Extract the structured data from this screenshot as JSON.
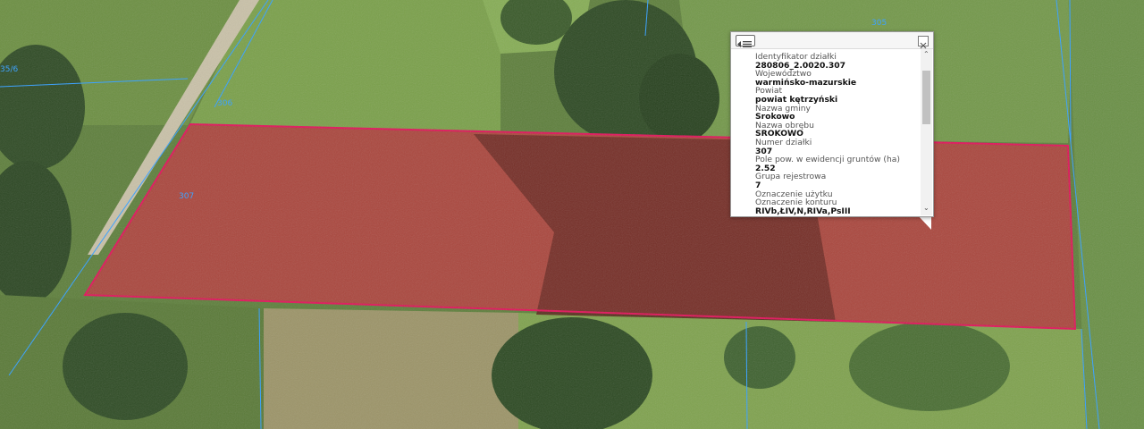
{
  "map": {
    "parcel_labels": [
      "305",
      "306",
      "307",
      "35/6"
    ],
    "colors": {
      "parcel_outline": "#e0145a",
      "parcel_fill": "#c0263e",
      "boundary_lines": "#3ea3ff"
    }
  },
  "popup": {
    "menu_icon": "list-menu-icon",
    "close_icon": "close-icon",
    "fields": [
      {
        "label": "Identyfikator działki",
        "value": "280806_2.0020.307"
      },
      {
        "label": "Województwo",
        "value": "warmińsko-mazurskie"
      },
      {
        "label": "Powiat",
        "value": "powiat kętrzyński"
      },
      {
        "label": "Nazwa gminy",
        "value": "Srokowo"
      },
      {
        "label": "Nazwa obrębu",
        "value": "SROKOWO"
      },
      {
        "label": "Numer działki",
        "value": "307"
      },
      {
        "label": "Pole pow. w ewidencji gruntów (ha)",
        "value": "2.52"
      },
      {
        "label": "Grupa rejestrowa",
        "value": "7"
      },
      {
        "label": "Oznaczenie użytku",
        "value": ""
      },
      {
        "label": "Oznaczenie konturu",
        "value": "RIVb,ŁIV,N,RIVa,PsIII"
      }
    ]
  }
}
